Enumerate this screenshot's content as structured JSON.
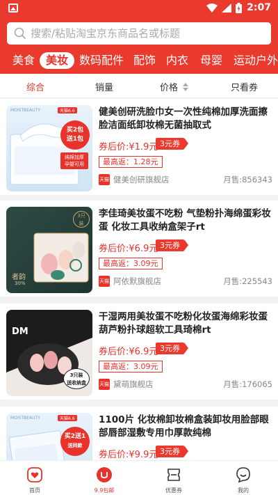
{
  "statusbar": {
    "time": "2:07"
  },
  "search": {
    "placeholder": "搜索/粘贴淘宝京东商品名或标题"
  },
  "categories": [
    "美食",
    "美妆",
    "数码配件",
    "配饰",
    "内衣",
    "母婴",
    "运动户外"
  ],
  "active_category": "美妆",
  "sort": {
    "default": "综合",
    "sales": "销量",
    "price": "价格",
    "coupon_only": "只看券"
  },
  "products": [
    {
      "title": "健美创研洗脸巾女一次性纯棉加厚洗面擦脸洁面纸卸妆棉无菌抽取式",
      "price_label": "券后价:",
      "price": "¥1.9元",
      "coupon": "3元券",
      "rebate": "最高返：1.28元",
      "shop_badge": "天猫",
      "shop": "健美创研旗舰店",
      "sales": "月售:856343",
      "image_text": [
        "MOISTBEAUTY",
        "天猫6.6",
        "买2包",
        "送1包",
        "纯棉加厚",
        "孕婴可用"
      ]
    },
    {
      "title": "李佳琦美妆蛋不吃粉 气垫粉扑海绵蛋彩妆蛋 化妆工具收纳盒架子rt",
      "price_label": "券后价:",
      "price": "¥6.9元",
      "coupon": "3元券",
      "rebate": "最高返：3.09元",
      "shop_badge": "天猫",
      "shop": "阿依默旗舰店",
      "sales": "月售:225543",
      "image_text": [
        "3只",
        "装",
        "者韵",
        "30%"
      ]
    },
    {
      "title": "干湿两用美妆蛋不吃粉化妆蛋海绵彩妆蛋葫芦粉扑球超软工具琦棉rt",
      "price_label": "券后价:",
      "price": "¥6.9元",
      "coupon": "3元券",
      "rebate": "最高返：3.09元",
      "shop_badge": "天猫",
      "shop": "黛萌旗舰店",
      "sales": "月售:176065",
      "image_text": [
        "DM",
        "3只装",
        "送收纳盒"
      ]
    },
    {
      "title": "1100片 化妆棉卸妆棉盒装卸妆用脸部眼部唇部湿敷专用巾厚款纯棉",
      "price_label": "券后价:",
      "price": "¥9.9元",
      "coupon": "3元券",
      "rebate": "",
      "shop_badge": "",
      "shop": "",
      "sales": "",
      "image_text": [
        "MOISTBEAUTY",
        "天猫6.6",
        "买2送1",
        "送同款"
      ]
    }
  ],
  "tabs": [
    {
      "label": "首页",
      "icon": "home-icon"
    },
    {
      "label": "9.9包邮",
      "icon": "free-shipping-icon"
    },
    {
      "label": "优惠券",
      "icon": "coupon-icon"
    },
    {
      "label": "我的",
      "icon": "profile-icon"
    }
  ],
  "colors": {
    "brand": "#ea3a2e",
    "accent": "#e8322a",
    "background": "#f2f2f2"
  }
}
